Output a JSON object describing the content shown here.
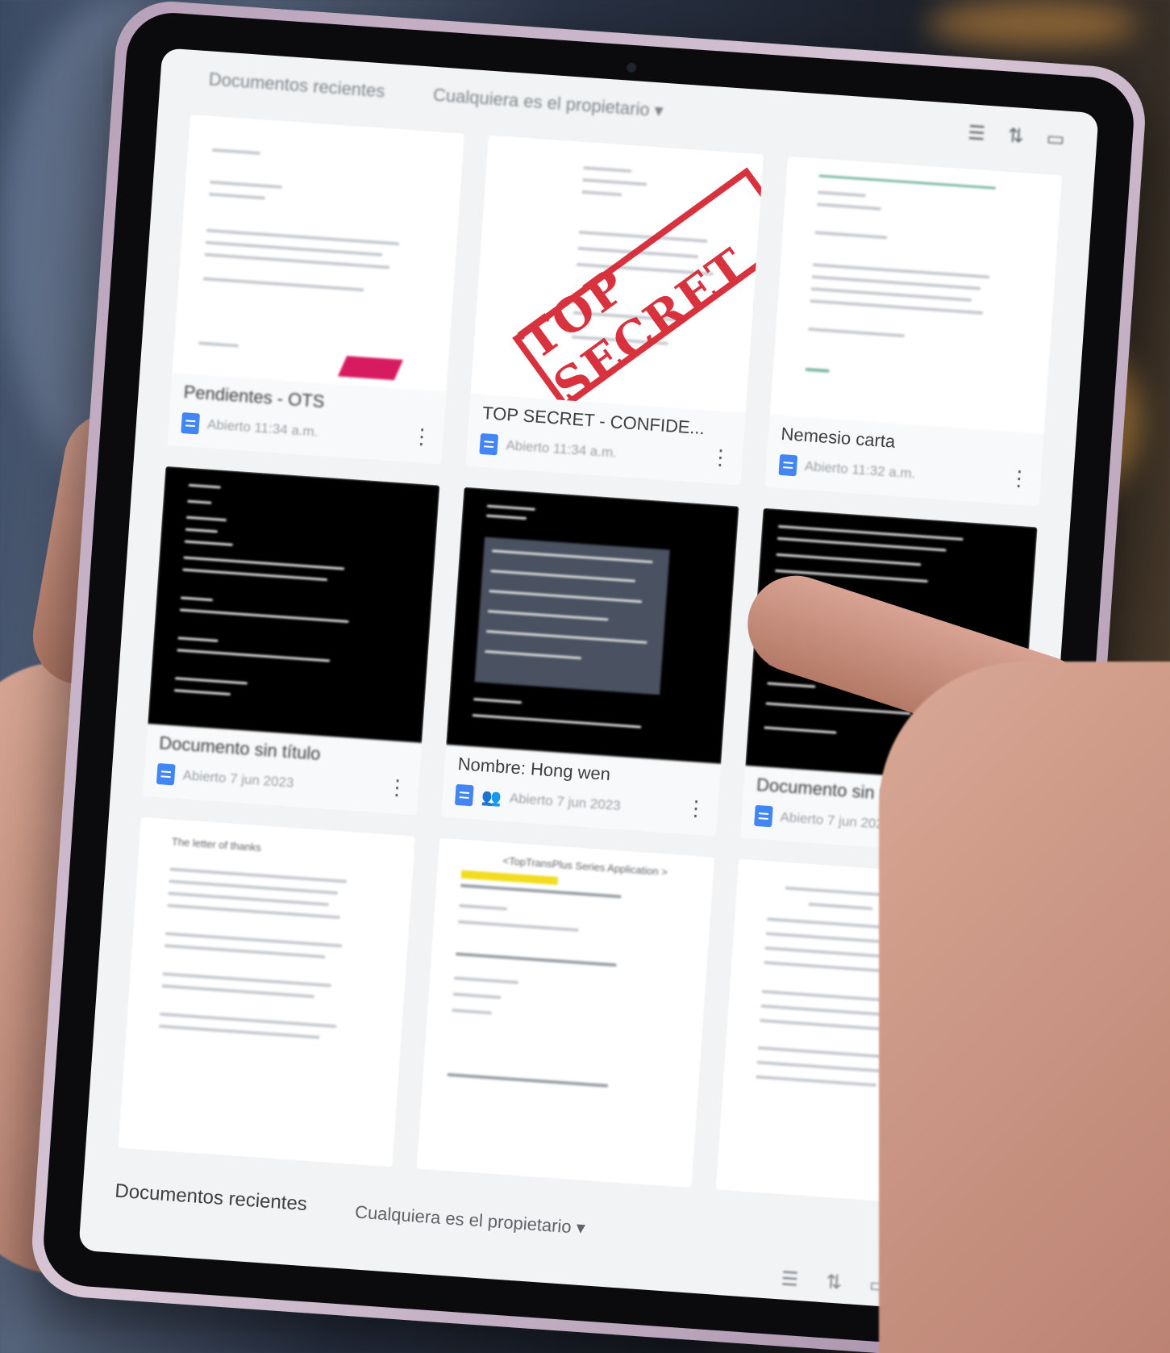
{
  "top_bar": {
    "title": "Documentos recientes",
    "owner_filter": "Cualquiera es el propietario ▾",
    "icons": [
      "list-view-icon",
      "sort-az-icon",
      "folder-icon"
    ]
  },
  "documents": [
    {
      "name": "Pendientes - OTS",
      "opened": "Abierto 11:34 a.m.",
      "thumb": "white",
      "shared": false
    },
    {
      "name": "TOP SECRET - CONFIDE...",
      "opened": "Abierto 11:34 a.m.",
      "thumb": "white",
      "stamp": "TOP SECRET",
      "shared": false
    },
    {
      "name": "Nemesio carta",
      "opened": "Abierto 11:32 a.m.",
      "thumb": "white",
      "shared": false
    },
    {
      "name": "Documento sin título",
      "opened": "Abierto 7 jun 2023",
      "thumb": "dark",
      "shared": false
    },
    {
      "name": "Nombre: Hong wen",
      "opened": "Abierto 7 jun 2023",
      "thumb": "dark",
      "shared": true
    },
    {
      "name": "Documento sin título",
      "opened": "Abierto 7 jun 2023",
      "thumb": "dark",
      "shared": false
    },
    {
      "name": "",
      "opened": "",
      "thumb": "white",
      "heading": "The letter of thanks",
      "shared": false
    },
    {
      "name": "",
      "opened": "",
      "thumb": "white",
      "heading": "<TopTransPlus Series Application >",
      "shared": false
    },
    {
      "name": "",
      "opened": "",
      "thumb": "white",
      "shared": false
    }
  ],
  "bottom_bar": {
    "title": "Documentos recientes",
    "owner_filter": "Cualquiera es el propietario ▾",
    "icons": [
      "list-view-icon",
      "sort-az-icon",
      "folder-icon"
    ]
  },
  "colors": {
    "doc_icon": "#4285f4",
    "stamp": "#d5212f",
    "screen_bg": "#f1f3f4",
    "tablet_frame": "#c8b3c8"
  }
}
